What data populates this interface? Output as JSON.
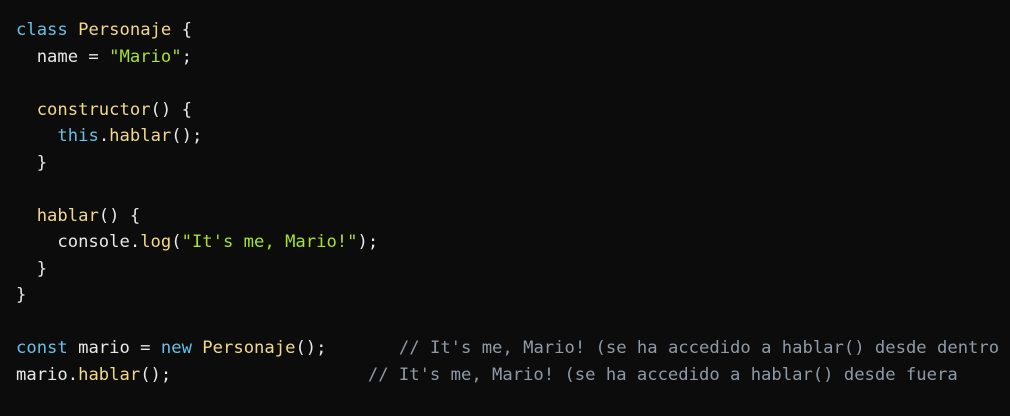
{
  "theme": {
    "background": "#0c0c0c",
    "colors": {
      "keyword": "#67c0e6",
      "class": "#f2d98a",
      "function": "#f2d98a",
      "string": "#a6e22e",
      "comment": "#8f9aa7",
      "plain": "#e8e8e8",
      "punct": "#e8e8e8"
    }
  },
  "code": {
    "lines": [
      [
        {
          "t": "class",
          "c": "keyword"
        },
        {
          "t": " ",
          "c": "plain"
        },
        {
          "t": "Personaje",
          "c": "class"
        },
        {
          "t": " {",
          "c": "punct"
        }
      ],
      [
        {
          "t": "  name = ",
          "c": "plain"
        },
        {
          "t": "\"Mario\"",
          "c": "string"
        },
        {
          "t": ";",
          "c": "punct"
        }
      ],
      [],
      [
        {
          "t": "  ",
          "c": "plain"
        },
        {
          "t": "constructor",
          "c": "function"
        },
        {
          "t": "() {",
          "c": "punct"
        }
      ],
      [
        {
          "t": "    ",
          "c": "plain"
        },
        {
          "t": "this",
          "c": "keyword"
        },
        {
          "t": ".",
          "c": "punct"
        },
        {
          "t": "hablar",
          "c": "function"
        },
        {
          "t": "();",
          "c": "punct"
        }
      ],
      [
        {
          "t": "  }",
          "c": "punct"
        }
      ],
      [],
      [
        {
          "t": "  ",
          "c": "plain"
        },
        {
          "t": "hablar",
          "c": "function"
        },
        {
          "t": "() {",
          "c": "punct"
        }
      ],
      [
        {
          "t": "    console.",
          "c": "plain"
        },
        {
          "t": "log",
          "c": "function"
        },
        {
          "t": "(",
          "c": "punct"
        },
        {
          "t": "\"It's me, Mario!\"",
          "c": "string"
        },
        {
          "t": ");",
          "c": "punct"
        }
      ],
      [
        {
          "t": "  }",
          "c": "punct"
        }
      ],
      [
        {
          "t": "}",
          "c": "punct"
        }
      ],
      [],
      [
        {
          "t": "const",
          "c": "keyword"
        },
        {
          "t": " mario = ",
          "c": "plain"
        },
        {
          "t": "new",
          "c": "keyword"
        },
        {
          "t": " ",
          "c": "plain"
        },
        {
          "t": "Personaje",
          "c": "class"
        },
        {
          "t": "();",
          "c": "punct"
        },
        {
          "t": "       ",
          "c": "plain"
        },
        {
          "t": "// It's me, Mario! (se ha accedido a hablar() desde dentro",
          "c": "comment"
        }
      ],
      [
        {
          "t": "mario.",
          "c": "plain"
        },
        {
          "t": "hablar",
          "c": "function"
        },
        {
          "t": "();",
          "c": "punct"
        },
        {
          "t": "                   ",
          "c": "plain"
        },
        {
          "t": "// It's me, Mario! (se ha accedido a hablar() desde fuera",
          "c": "comment"
        }
      ]
    ]
  }
}
